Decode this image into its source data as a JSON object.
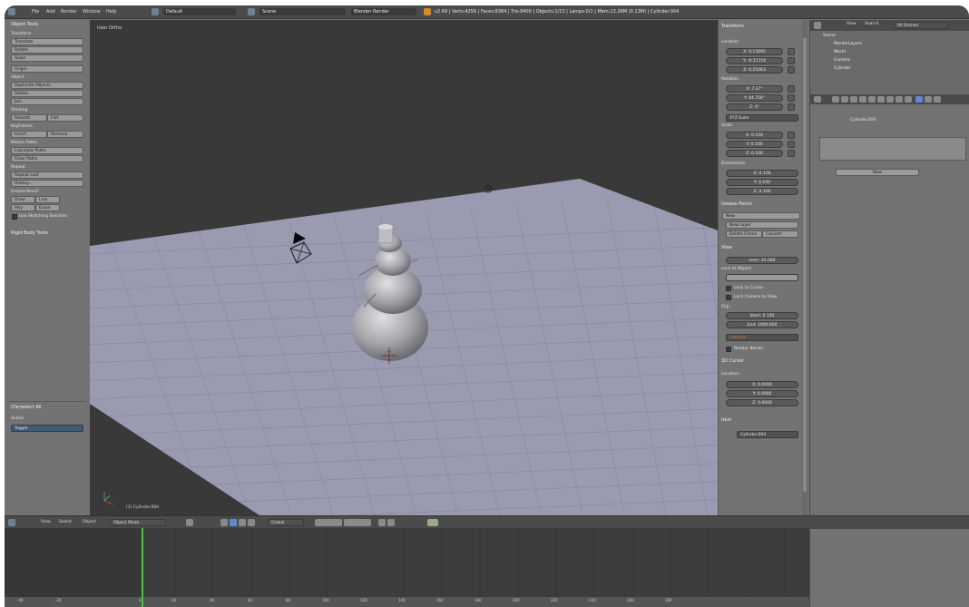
{
  "colors": {
    "accent": "#5d6f8a",
    "playhead": "#3ec83e",
    "grid_plane": "#9a9bb0"
  },
  "topbar": {
    "menu": [
      "File",
      "Add",
      "Render",
      "Window",
      "Help"
    ],
    "layout": "Default",
    "scene": "Scene",
    "engine": "Blender Render",
    "stats": "v2.69 | Verts:4256 | Faces:8384 | Tris:8400 | Objects:1/13 | Lamps:0/1 | Mem:13.26M (0.13M) | Cylinder.004"
  },
  "toolshelf": {
    "title": "Object Tools",
    "transform": {
      "title": "Transform",
      "buttons": [
        "Translate",
        "Rotate",
        "Scale",
        "Origin"
      ]
    },
    "object": {
      "title": "Object",
      "buttons": [
        "Duplicate Objects",
        "Delete",
        "Join"
      ]
    },
    "shading": {
      "title": "Shading",
      "smooth": "Smooth",
      "flat": "Flat"
    },
    "keyframes": {
      "title": "Keyframes",
      "insert": "Insert",
      "remove": "Remove"
    },
    "motion": {
      "title": "Motion Paths",
      "calculate": "Calculate Paths",
      "clear": "Clear Paths"
    },
    "repeat": {
      "title": "Repeat",
      "last": "Repeat Last",
      "history": "History..."
    },
    "grease": {
      "title": "Grease Pencil",
      "draw": "Draw",
      "line": "Line",
      "poly": "Poly",
      "erase": "Erase",
      "sketch": "Use Sketching Sessions"
    },
    "rigid": "Rigid Body Tools",
    "op": {
      "title": "(De)select All",
      "action_label": "Action",
      "action": "Toggle"
    }
  },
  "viewport": {
    "label": "User Ortho",
    "object": "(1) Cylinder.004"
  },
  "npanel": {
    "transform_title": "Transform",
    "location_label": "Location",
    "location": [
      "X: 0.13095",
      "Y: -0.11716",
      "Z: 0.25463"
    ],
    "rotation_label": "Rotation",
    "rotation": [
      "X: 7.27°",
      "Y: 44.756°",
      "Z: 0°"
    ],
    "rot_mode": "XYZ Euler",
    "scale_label": "Scale",
    "scale": [
      "X: 0.100",
      "Y: 0.100",
      "Z: 0.100"
    ],
    "dim_label": "Dimensions",
    "dims": [
      "X: 0.100",
      "Y: 0.100",
      "Z: 0.100"
    ],
    "grease_title": "Grease Pencil",
    "new": "New",
    "new_layer": "New Layer",
    "delete_frame": "Delete Frame",
    "convert": "Convert",
    "view_title": "View",
    "lens": "Lens: 35.000",
    "lock_obj": "Lock to Object:",
    "lock_cursor": "Lock to Cursor",
    "lock_cam": "Lock Camera to View",
    "clip_label": "Clip:",
    "clip_start": "Start: 0.100",
    "clip_end": "End: 1000.000",
    "local_cam": "Camera",
    "render_border": "Render Border",
    "cursor_title": "3D Cursor",
    "cursor_loc_label": "Location:",
    "cursor": [
      "X: 0.0000",
      "Y: 0.0000",
      "Z: 0.0000"
    ],
    "item_title": "Item",
    "item_name": "Cylinder.004"
  },
  "outliner": {
    "view": "View",
    "search": "Search",
    "filter": "All Scenes",
    "rows": [
      {
        "label": "Scene"
      },
      {
        "label": "RenderLayers"
      },
      {
        "label": "World"
      },
      {
        "label": "Camera"
      },
      {
        "label": "Cylinder"
      }
    ]
  },
  "properties": {
    "object": "Cylinder.004",
    "new": "New"
  },
  "timeline": {
    "menu": [
      "View",
      "Select",
      "Object"
    ],
    "mode": "Object Mode",
    "pivot": "Global",
    "ticks": [
      "-40",
      "-20",
      "0",
      "20",
      "40",
      "60",
      "80",
      "100",
      "120",
      "140",
      "160",
      "180",
      "200",
      "220",
      "240",
      "260",
      "280"
    ]
  }
}
